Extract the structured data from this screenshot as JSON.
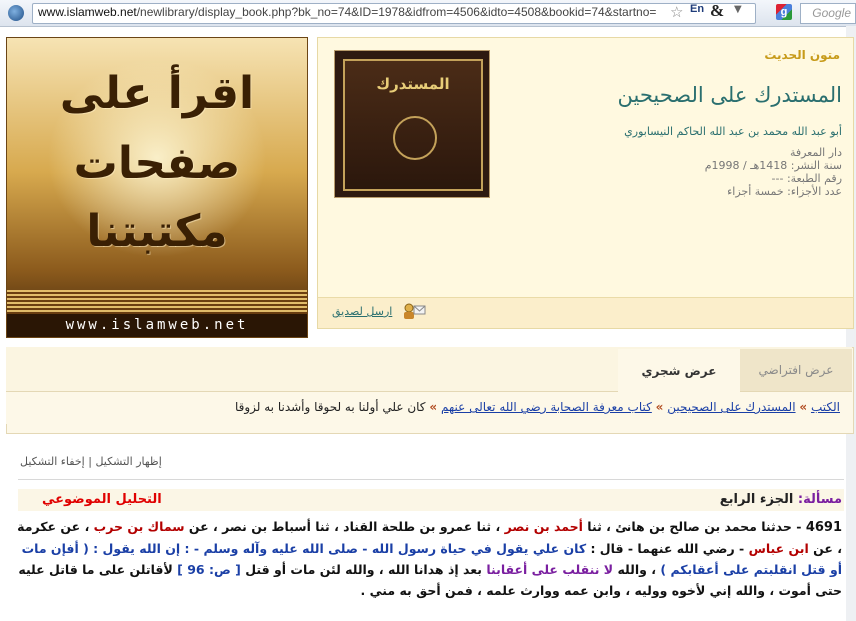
{
  "browser": {
    "url_host": "www.islamweb.net",
    "url_path": "/newlibrary/display_book.php?bk_no=74&ID=1978&idfrom=4506&idto=4508&bookid=74&startno=",
    "lang_badge": "En",
    "amp_icon": "&",
    "search_placeholder": "Google",
    "google_letter": "g"
  },
  "banner": {
    "line1": "اقرأ على",
    "line2": "صفحات",
    "line3": "مكتبتنا",
    "site": "www.islamweb.net"
  },
  "book": {
    "category": "متون الحديث",
    "title": "المستدرك على الصحيحين",
    "author": "أبو عبد الله محمد بن عبد الله الحاكم النيسابوري",
    "publisher": "دار المعرفة",
    "pub_year": "سنة النشر: 1418هـ / 1998م",
    "edition": "رقم الطبعة: ---",
    "volumes": "عدد الأجزاء: خمسة أجزاء",
    "cover_text": "المستدرك"
  },
  "actions": {
    "send_to_friend": "ارسل لصديق"
  },
  "tabs": {
    "default_view": "عرض افتراضي",
    "tree_view": "عرض شجري"
  },
  "breadcrumb": {
    "root": "الكتب",
    "book": "المستدرك على الصحيحين",
    "section": "كتاب معرفة الصحابة رضي الله تعالى عنهم",
    "current": "كان علي أولنا به لحوقا وأشدنا به لزوقا",
    "sep": "»"
  },
  "toggles": {
    "show_tashkeel": "إظهار التشكيل",
    "divider": "|",
    "hide_tashkeel": "إخفاء التشكيل"
  },
  "content": {
    "masala_label": "مسألة:",
    "masala_value": "الجزء الرابع",
    "topical_link": "التحليل الموضوعي",
    "hadith_number": "4691",
    "t1": " - حدثنا محمد بن صالح بن هانئ ، ثنا ",
    "n1": "أحمد بن نصر",
    "t2": " ، ثنا عمرو بن طلحة القناد ، ثنا أسباط بن نصر ، عن ",
    "n2": "سماك بن حرب",
    "t3": " ، عن عكرمة ، عن ",
    "n3": "ابن عباس",
    "t4": " - رضي الله عنهما - قال : ",
    "q1": "كان علي يقول في حياة رسول الله - صلى الله عليه وآله وسلم - : إن الله يقول : ( أفإن مات أو قتل انقلبتم على أعقابكم )",
    "t5": " ، والله ",
    "h1": "لا ننقلب على أعقابنا",
    "t6": " بعد إذ هدانا الله ، والله لئن مات أو قتل ",
    "pg": "[ ص: 96 ]",
    "t7": " لأقاتلن على ما قاتل عليه حتى أموت ، والله إني لأخوه ووليه ، وابن عمه ووارث علمه ، فمن أحق به مني ."
  }
}
